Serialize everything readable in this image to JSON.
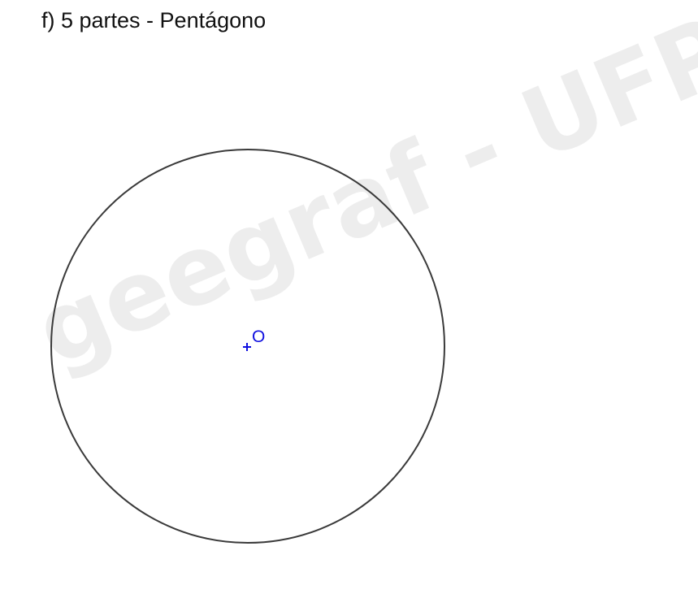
{
  "title": "f) 5 partes - Pentágono",
  "watermark": "geegraf - UFPR",
  "figure": {
    "center_label": "O",
    "colors": {
      "circle": "#3a3a3a",
      "center": "#1010e0"
    }
  }
}
